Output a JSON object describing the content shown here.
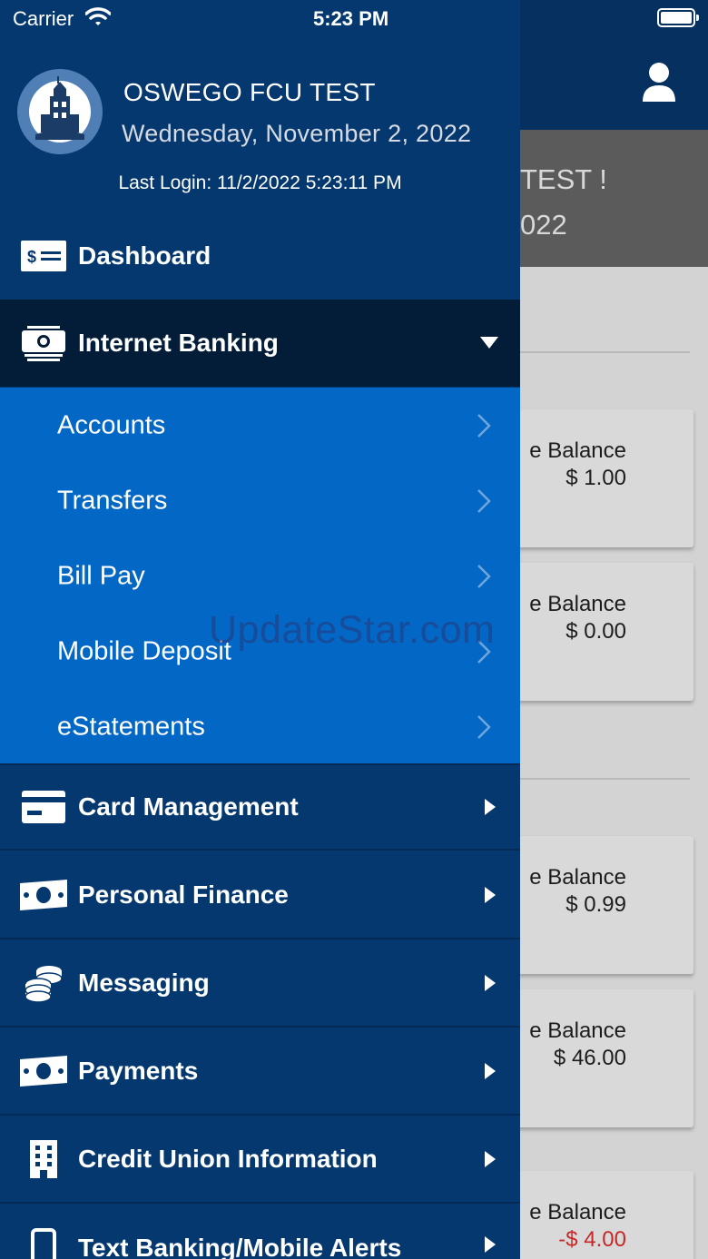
{
  "status_bar": {
    "carrier": "Carrier",
    "time": "5:23 PM"
  },
  "background": {
    "welcome_line1": "TEST !",
    "welcome_line2": "022",
    "cards": [
      {
        "label": "e Balance",
        "value": "$ 1.00",
        "negative": false
      },
      {
        "label": "e Balance",
        "value": "$ 0.00",
        "negative": false
      },
      {
        "label": "e Balance",
        "value": "$ 0.99",
        "negative": false
      },
      {
        "label": "e Balance",
        "value": "$ 46.00",
        "negative": false
      },
      {
        "label": "e Balance",
        "value": "-$ 4.00",
        "negative": true
      }
    ],
    "negative_color": "#c62828"
  },
  "drawer": {
    "org_name": "OSWEGO FCU TEST",
    "date": "Wednesday, November 2, 2022",
    "last_login": "Last Login: 11/2/2022 5:23:11 PM",
    "menu": [
      {
        "label": "Dashboard",
        "icon": "dollar-bill-icon"
      },
      {
        "label": "Internet Banking",
        "icon": "money-stack-icon",
        "expanded": true
      },
      {
        "label": "Card Management",
        "icon": "credit-card-icon"
      },
      {
        "label": "Personal Finance",
        "icon": "cash-icon"
      },
      {
        "label": "Messaging",
        "icon": "coins-icon"
      },
      {
        "label": "Payments",
        "icon": "cash-icon"
      },
      {
        "label": "Credit Union Information",
        "icon": "building-icon"
      },
      {
        "label": "Text Banking/Mobile Alerts",
        "icon": "mobile-phone-icon"
      }
    ],
    "submenu": [
      {
        "label": "Accounts"
      },
      {
        "label": "Transfers"
      },
      {
        "label": "Bill Pay"
      },
      {
        "label": "Mobile Deposit"
      },
      {
        "label": "eStatements"
      }
    ]
  },
  "watermark": "UpdateStar.com",
  "colors": {
    "drawer_bg": "#05386f",
    "active_item_bg": "#031c37",
    "submenu_bg": "#0367c5",
    "topbar_bg": "#05305f"
  }
}
